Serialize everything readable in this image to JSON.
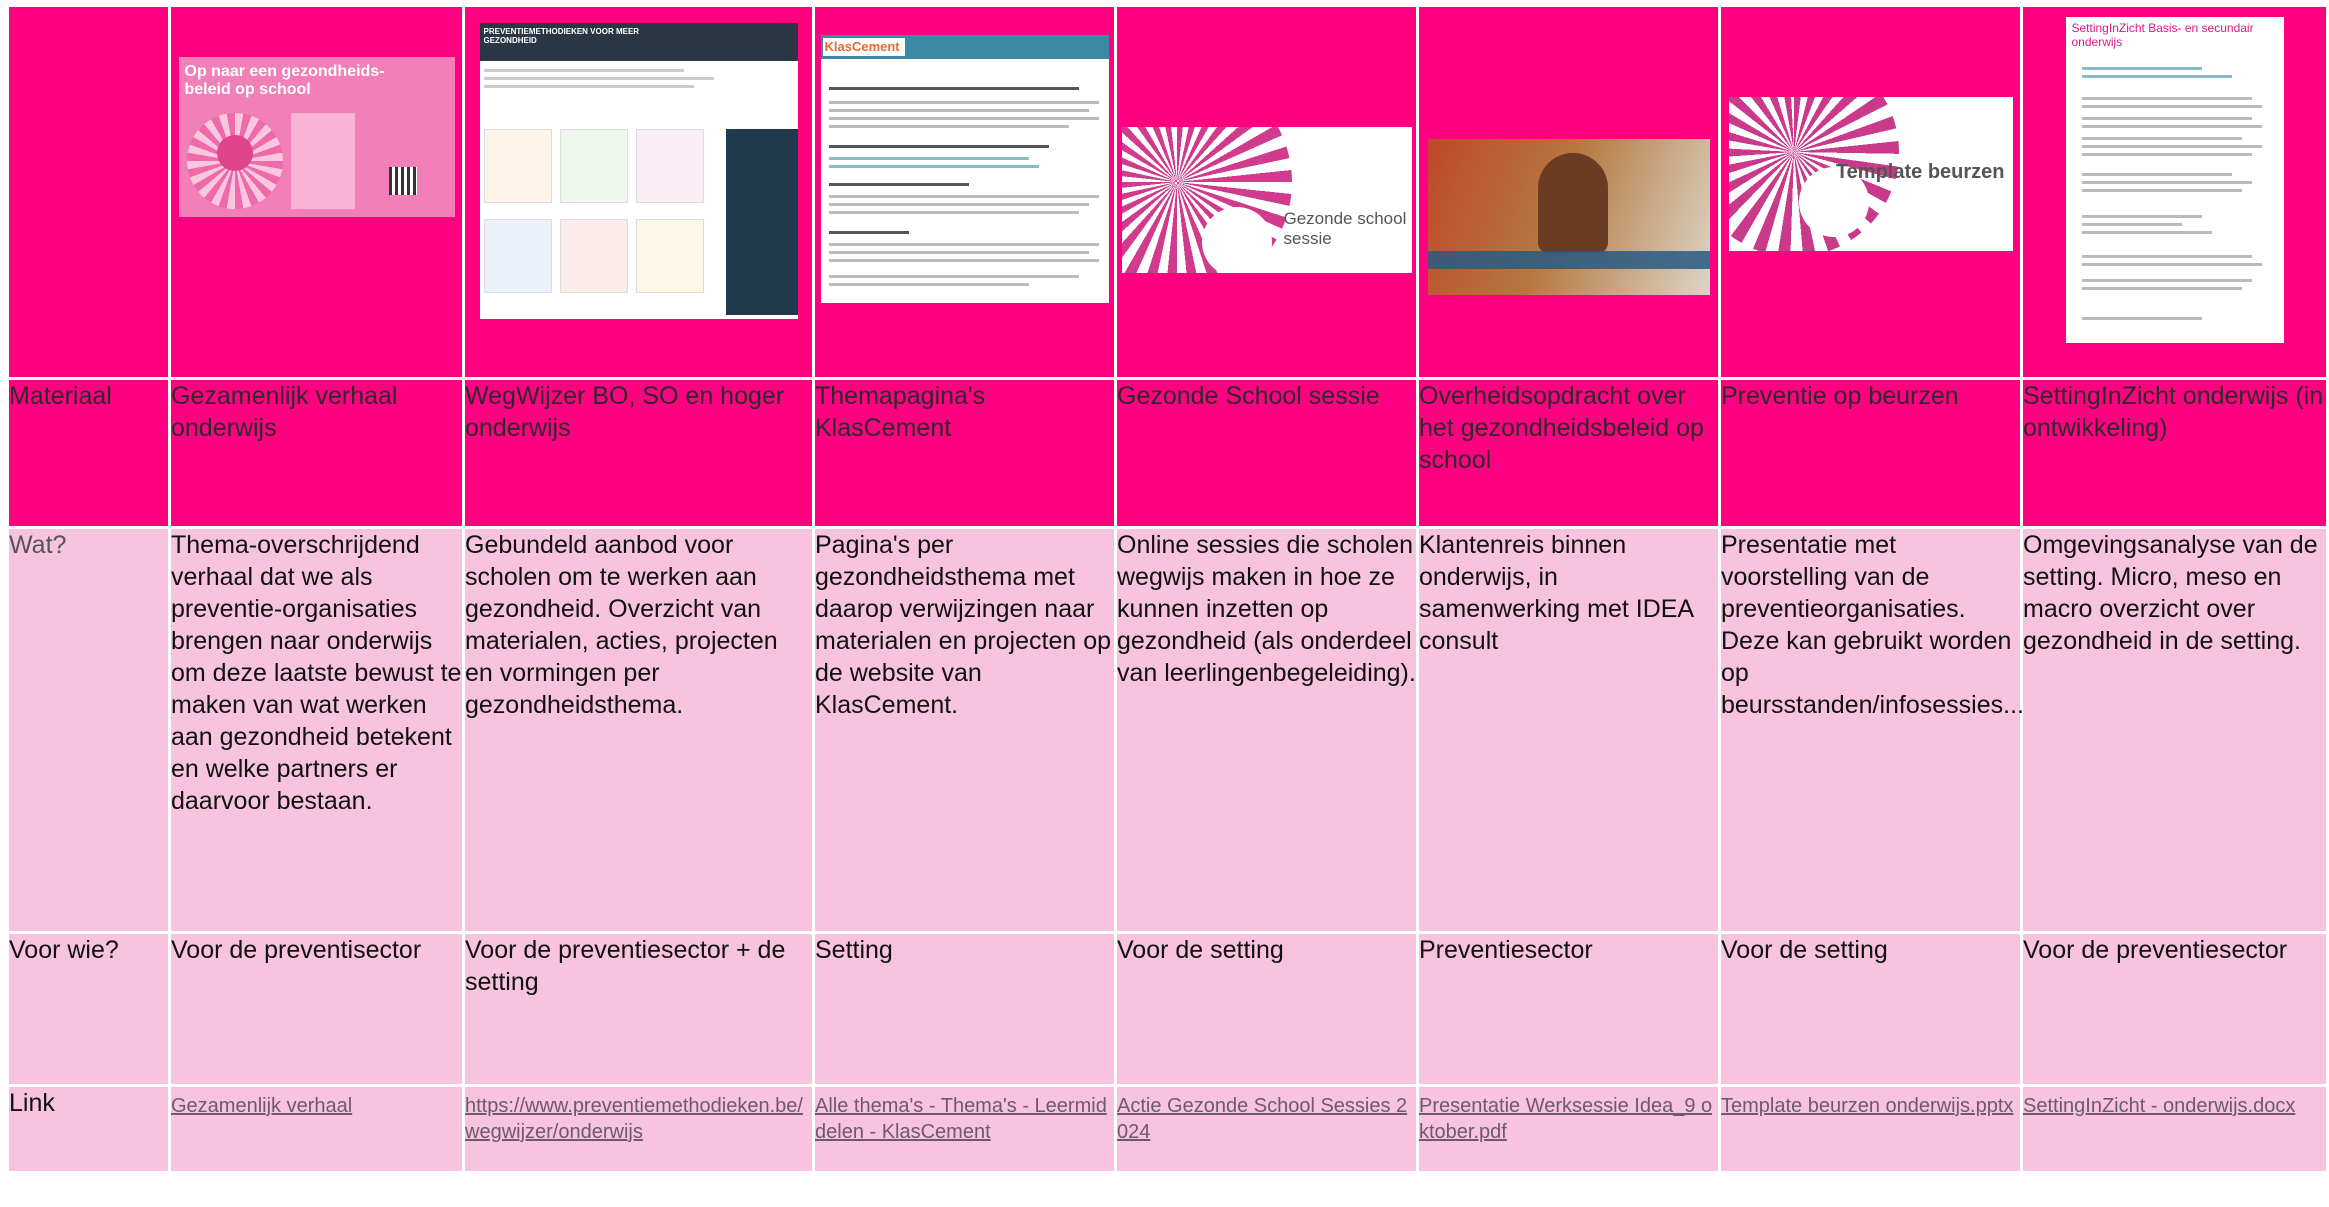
{
  "colors": {
    "header_magenta": "#ff0080",
    "body_pink": "#f8c3de",
    "link_color": "#6b5b6b"
  },
  "row_labels": {
    "materiaal": "Materiaal",
    "wat": "Wat?",
    "voor_wie": "Voor wie?",
    "link": "Link"
  },
  "thumbnails": {
    "t1_title": "Op naar een gezondheids-beleid op school",
    "t2_title": "PREVENTIEMETHODIEKEN VOOR MEER GEZONDHEID",
    "t3_logo": "KlasCement",
    "t4_title": "Gezonde school sessie",
    "t6_title": "Template beurzen",
    "t7_title": "SettingInZicht Basis- en secundair onderwijs"
  },
  "columns": [
    {
      "materiaal": "Gezamenlijk verhaal onderwijs",
      "wat": "Thema-overschrijdend verhaal dat we als preventie-organisaties brengen naar onderwijs om deze laatste bewust te maken van wat werken aan gezondheid betekent en welke partners er daarvoor bestaan.",
      "voor_wie": "Voor de preventisector",
      "link": "Gezamenlijk verhaal"
    },
    {
      "materiaal": "WegWijzer BO, SO en hoger onderwijs",
      "wat": "Gebundeld aanbod voor scholen om te werken aan gezondheid. Overzicht van materialen, acties, projecten en vormingen per gezondheidsthema.",
      "voor_wie": "Voor de preventiesector + de setting",
      "link": "https://www.preventiemethodieken.be/wegwijzer/onderwijs"
    },
    {
      "materiaal": "Themapagina's KlasCement",
      "wat": "Pagina's per gezondheidsthema met daarop verwijzingen naar materialen en projecten op de website van KlasCement.",
      "voor_wie": "Setting",
      "link": "Alle thema's - Thema's - Leermiddelen - KlasCement"
    },
    {
      "materiaal": "Gezonde School sessie",
      "wat": "Online sessies die scholen wegwijs maken in hoe ze kunnen inzetten op gezondheid (als onderdeel van leerlingenbegeleiding).",
      "voor_wie": "Voor de setting",
      "link": "Actie Gezonde School Sessies 2024"
    },
    {
      "materiaal": "Overheidsopdracht over het gezondheidsbeleid op school",
      "wat": "Klantenreis binnen onderwijs, in samenwerking met IDEA consult",
      "voor_wie": "Preventiesector",
      "link": "Presentatie Werksessie Idea_9 oktober.pdf"
    },
    {
      "materiaal": "Preventie op beurzen",
      "wat": "Presentatie met voorstelling van de preventieorganisaties. Deze kan gebruikt worden op beursstanden/infosessies...",
      "voor_wie": "Voor de setting",
      "link": "Template beurzen onderwijs.pptx"
    },
    {
      "materiaal": "SettingInZicht onderwijs (in ontwikkeling)",
      "wat": "Omgevingsanalyse van de setting. Micro, meso en macro overzicht over gezondheid in de setting.",
      "voor_wie": "Voor de preventiesector",
      "link": "SettingInZicht - onderwijs.docx"
    }
  ]
}
